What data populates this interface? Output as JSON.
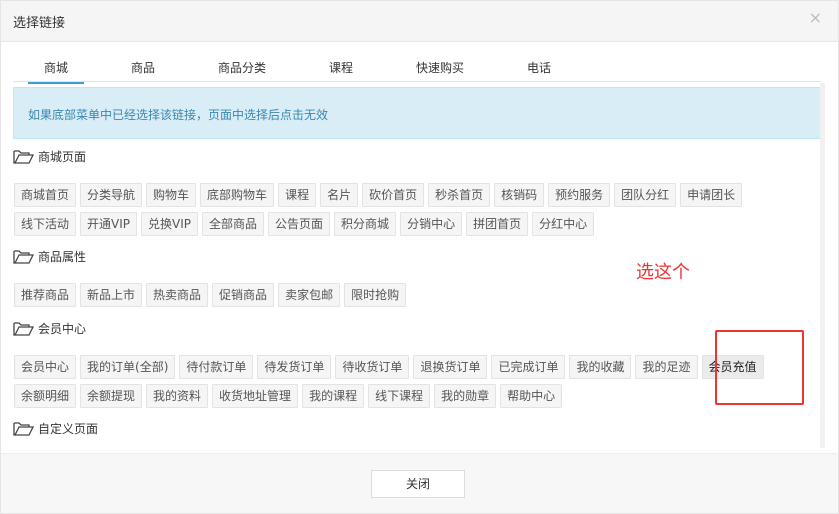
{
  "dialog": {
    "title": "选择链接",
    "close_symbol": "×",
    "alert": "如果底部菜单中已经选择该链接，页面中选择后点击无效",
    "close_button": "关闭"
  },
  "tabs": [
    {
      "label": "商城"
    },
    {
      "label": "商品"
    },
    {
      "label": "商品分类"
    },
    {
      "label": "课程"
    },
    {
      "label": "快速购买"
    },
    {
      "label": "电话"
    }
  ],
  "sections": {
    "mall": {
      "title": "商城页面",
      "row1": [
        "商城首页",
        "分类导航",
        "购物车",
        "底部购物车",
        "课程",
        "名片",
        "砍价首页",
        "秒杀首页",
        "核销码",
        "预约服务",
        "团队分红",
        "申请团长"
      ],
      "row2": [
        "线下活动",
        "开通VIP",
        "兑换VIP",
        "全部商品",
        "公告页面",
        "积分商城",
        "分销中心",
        "拼团首页",
        "分红中心"
      ]
    },
    "goods": {
      "title": "商品属性",
      "row1": [
        "推荐商品",
        "新品上市",
        "热卖商品",
        "促销商品",
        "卖家包邮",
        "限时抢购"
      ]
    },
    "member": {
      "title": "会员中心",
      "row1": [
        "会员中心",
        "我的订单(全部)",
        "待付款订单",
        "待发货订单",
        "待收货订单",
        "退换货订单",
        "已完成订单",
        "我的收藏",
        "我的足迹",
        "会员充值"
      ],
      "row2": [
        "余额明细",
        "余额提现",
        "我的资料",
        "收货地址管理",
        "我的课程",
        "线下课程",
        "我的勋章",
        "帮助中心"
      ]
    },
    "custom": {
      "title": "自定义页面"
    }
  },
  "annotation": {
    "text": "选这个",
    "color": "#ee3333"
  },
  "icons": {
    "section": "folder-open-icon",
    "close": "close-icon"
  }
}
